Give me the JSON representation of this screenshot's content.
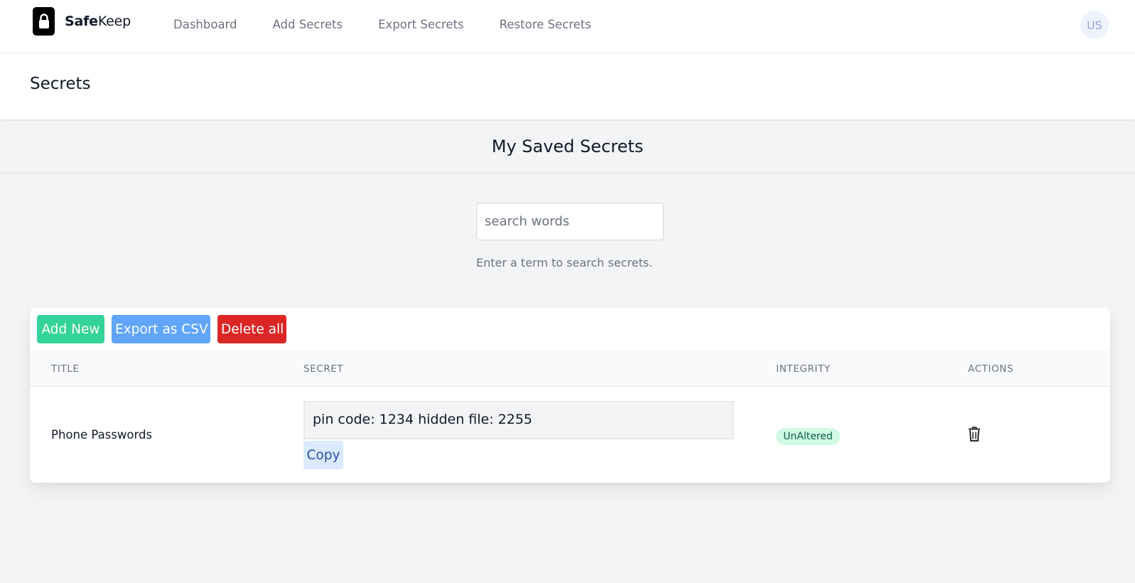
{
  "brand": {
    "name_bold": "Safe",
    "name_light": "Keep",
    "logo_icon": "lock-icon"
  },
  "nav": {
    "links": [
      {
        "label": "Dashboard"
      },
      {
        "label": "Add Secrets"
      },
      {
        "label": "Export Secrets"
      },
      {
        "label": "Restore Secrets"
      }
    ],
    "avatar_initials": "US"
  },
  "page": {
    "title": "Secrets"
  },
  "section": {
    "title": "My Saved Secrets"
  },
  "search": {
    "placeholder": "search words",
    "value": "",
    "hint": "Enter a term to search secrets."
  },
  "toolbar": {
    "add_label": "Add New",
    "export_label": "Export as CSV",
    "delete_label": "Delete all"
  },
  "table": {
    "columns": [
      "Title",
      "Secret",
      "Integrity",
      "Actions"
    ],
    "rows": [
      {
        "title": "Phone Passwords",
        "secret": "pin code: 1234 hidden file: 2255",
        "copy_label": "Copy",
        "integrity": "UnAltered",
        "action_icon": "trash-icon"
      }
    ]
  },
  "colors": {
    "add": "#34d399",
    "export": "#60a5fa",
    "delete": "#dc2626",
    "badge_bg": "#d1fae5",
    "badge_text": "#065f46",
    "copy_bg": "#dbeafe"
  }
}
